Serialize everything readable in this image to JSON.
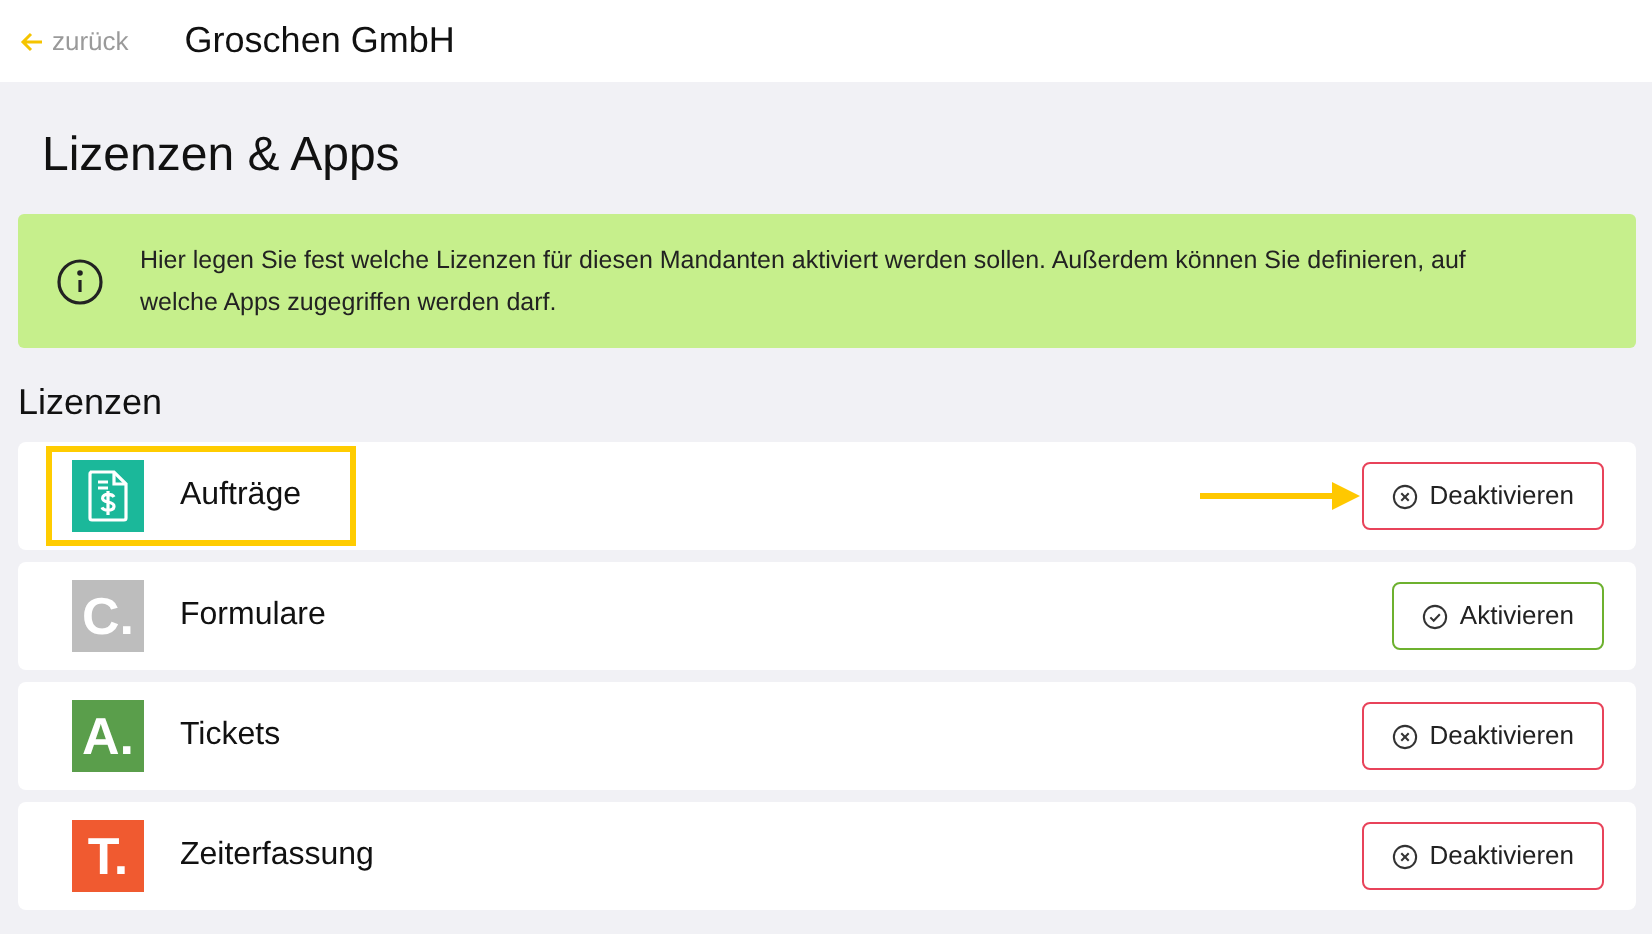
{
  "header": {
    "back_link": "zurück",
    "title": "Groschen GmbH"
  },
  "page_title": "Lizenzen & Apps",
  "info": "Hier legen Sie fest welche Lizenzen für diesen Mandanten aktiviert werden sollen. Außerdem können Sie definieren, auf welche Apps zugegriffen werden darf.",
  "section_title": "Lizenzen",
  "licenses": [
    {
      "name": "Aufträge",
      "kind": "document",
      "color": "#1bb89a",
      "active": true,
      "highlighted": true,
      "button": "Deaktivieren"
    },
    {
      "name": "Formulare",
      "kind": "letter",
      "logo_text": "C.",
      "color": "#bdbdbd",
      "active": false,
      "highlighted": false,
      "button": "Aktivieren"
    },
    {
      "name": "Tickets",
      "kind": "letter",
      "logo_text": "A.",
      "color": "#5a9e4b",
      "active": true,
      "highlighted": false,
      "button": "Deaktivieren"
    },
    {
      "name": "Zeiterfassung",
      "kind": "letter",
      "logo_text": "T.",
      "color": "#f05a30",
      "active": true,
      "highlighted": false,
      "button": "Deaktivieren"
    }
  ]
}
